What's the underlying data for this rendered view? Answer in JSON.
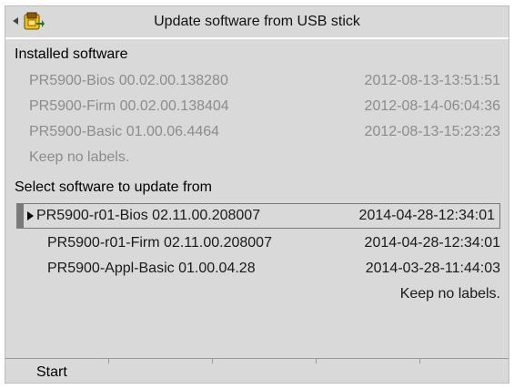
{
  "header": {
    "title": "Update software from USB stick",
    "back_icon": "back-arrow-icon",
    "device_icon": "usb-stick-icon"
  },
  "installed": {
    "heading": "Installed software",
    "items": [
      {
        "name": "PR5900-Bios 00.02.00.138280",
        "date": "2012-08-13-13:51:51"
      },
      {
        "name": "PR5900-Firm 00.02.00.138404",
        "date": "2012-08-14-06:04:36"
      },
      {
        "name": "PR5900-Basic 01.00.06.4464",
        "date": "2012-08-13-15:23:23"
      }
    ],
    "labels_note": "Keep no labels."
  },
  "update": {
    "heading": "Select software to update from",
    "items": [
      {
        "name": "PR5900-r01-Bios 02.11.00.208007",
        "date": "2014-04-28-12:34:01",
        "selected": true
      },
      {
        "name": "PR5900-r01-Firm 02.11.00.208007",
        "date": "2014-04-28-12:34:01"
      },
      {
        "name": "PR5900-Appl-Basic 01.00.04.28",
        "date": "2014-03-28-11:44:03"
      }
    ],
    "labels_note": "Keep no labels."
  },
  "softkeys": [
    "Start",
    "",
    "",
    "",
    ""
  ],
  "colors": {
    "background": "#d9d9d9",
    "inactive_text": "#8c8c8c",
    "active_text": "#1a1a1a"
  }
}
